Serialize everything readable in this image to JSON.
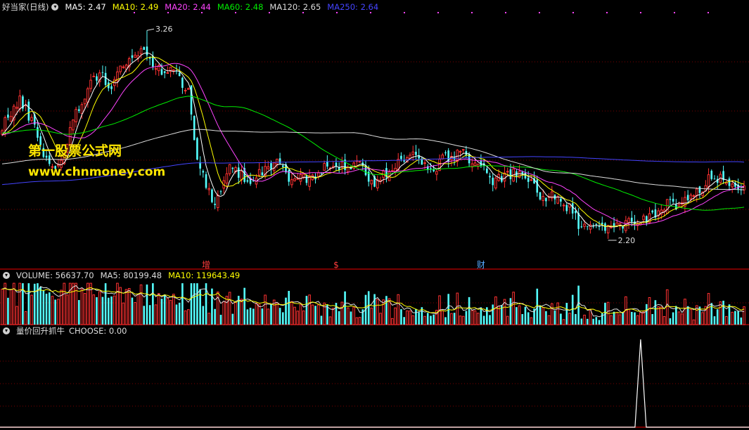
{
  "stock": {
    "name": "好当家(日线)"
  },
  "price_panel": {
    "ma_labels": [
      {
        "key": "ma5",
        "text": "MA5: 2.47",
        "color": "#ffffff"
      },
      {
        "key": "ma10",
        "text": "MA10: 2.49",
        "color": "#ffff00"
      },
      {
        "key": "ma20",
        "text": "MA20: 2.44",
        "color": "#ff44ff"
      },
      {
        "key": "ma60",
        "text": "MA60: 2.48",
        "color": "#00ee00"
      },
      {
        "key": "ma120",
        "text": "MA120: 2.65",
        "color": "#dddddd"
      },
      {
        "key": "ma250",
        "text": "MA250: 2.64",
        "color": "#4444ff"
      }
    ],
    "high_label": "3.26",
    "low_label": "2.20",
    "markers": [
      {
        "text": "增",
        "index": 69,
        "color": "#ff3c3c"
      },
      {
        "text": "$",
        "index": 113,
        "color": "#ff3c3c"
      },
      {
        "text": "财",
        "index": 162,
        "color": "#55aaff"
      }
    ]
  },
  "volume_panel": {
    "labels": [
      {
        "key": "volume",
        "text": "VOLUME: 56637.70",
        "color": "#dddddd"
      },
      {
        "key": "ma5",
        "text": "MA5: 80199.48",
        "color": "#dddddd"
      },
      {
        "key": "ma10",
        "text": "MA10: 119643.49",
        "color": "#ffff00"
      }
    ]
  },
  "indicator_panel": {
    "name": "量价回升抓牛",
    "choose_label": "CHOOSE: 0.00"
  },
  "watermark": {
    "title": "第一股票公式网",
    "url": "www.chnmoney.com"
  },
  "colors": {
    "up": "#ff3232",
    "down": "#54ffff",
    "divider": "#a00000",
    "grid": "#7a0000"
  },
  "chart_data": {
    "type": "candlestick",
    "title": "好当家(日线)",
    "price_range": [
      2.1,
      3.35
    ],
    "max_high": 3.26,
    "min_low": 2.2,
    "price_anchors": [
      [
        0,
        2.78
      ],
      [
        3,
        2.84
      ],
      [
        6,
        2.9
      ],
      [
        9,
        2.83
      ],
      [
        12,
        2.73
      ],
      [
        15,
        2.6
      ],
      [
        18,
        2.55
      ],
      [
        21,
        2.65
      ],
      [
        24,
        2.8
      ],
      [
        27,
        2.9
      ],
      [
        30,
        3.0
      ],
      [
        33,
        3.05
      ],
      [
        36,
        2.96
      ],
      [
        39,
        3.05
      ],
      [
        42,
        3.1
      ],
      [
        45,
        3.12
      ],
      [
        48,
        3.15
      ],
      [
        51,
        3.1
      ],
      [
        54,
        3.05
      ],
      [
        57,
        3.06
      ],
      [
        60,
        3.02
      ],
      [
        63,
        2.95
      ],
      [
        66,
        2.62
      ],
      [
        69,
        2.47
      ],
      [
        72,
        2.35
      ],
      [
        75,
        2.5
      ],
      [
        78,
        2.58
      ],
      [
        81,
        2.52
      ],
      [
        84,
        2.5
      ],
      [
        87,
        2.54
      ],
      [
        90,
        2.57
      ],
      [
        93,
        2.6
      ],
      [
        96,
        2.53
      ],
      [
        99,
        2.49
      ],
      [
        102,
        2.52
      ],
      [
        105,
        2.5
      ],
      [
        108,
        2.54
      ],
      [
        111,
        2.59
      ],
      [
        114,
        2.57
      ],
      [
        117,
        2.55
      ],
      [
        120,
        2.6
      ],
      [
        123,
        2.53
      ],
      [
        126,
        2.47
      ],
      [
        129,
        2.52
      ],
      [
        132,
        2.57
      ],
      [
        135,
        2.6
      ],
      [
        138,
        2.63
      ],
      [
        141,
        2.61
      ],
      [
        144,
        2.54
      ],
      [
        147,
        2.57
      ],
      [
        150,
        2.61
      ],
      [
        153,
        2.63
      ],
      [
        156,
        2.64
      ],
      [
        159,
        2.6
      ],
      [
        162,
        2.57
      ],
      [
        165,
        2.5
      ],
      [
        168,
        2.5
      ],
      [
        171,
        2.52
      ],
      [
        174,
        2.53
      ],
      [
        177,
        2.51
      ],
      [
        180,
        2.47
      ],
      [
        183,
        2.4
      ],
      [
        186,
        2.42
      ],
      [
        189,
        2.37
      ],
      [
        192,
        2.35
      ],
      [
        195,
        2.28
      ],
      [
        198,
        2.29
      ],
      [
        201,
        2.26
      ],
      [
        204,
        2.27
      ],
      [
        207,
        2.25
      ],
      [
        210,
        2.27
      ],
      [
        213,
        2.3
      ],
      [
        216,
        2.3
      ],
      [
        219,
        2.3
      ],
      [
        222,
        2.33
      ],
      [
        225,
        2.38
      ],
      [
        228,
        2.36
      ],
      [
        231,
        2.4
      ],
      [
        234,
        2.42
      ],
      [
        237,
        2.45
      ],
      [
        240,
        2.52
      ],
      [
        243,
        2.5
      ],
      [
        246,
        2.47
      ],
      [
        249,
        2.48
      ],
      [
        251,
        2.47
      ]
    ],
    "volume_max": 260000,
    "choose_spike_index": 216
  }
}
